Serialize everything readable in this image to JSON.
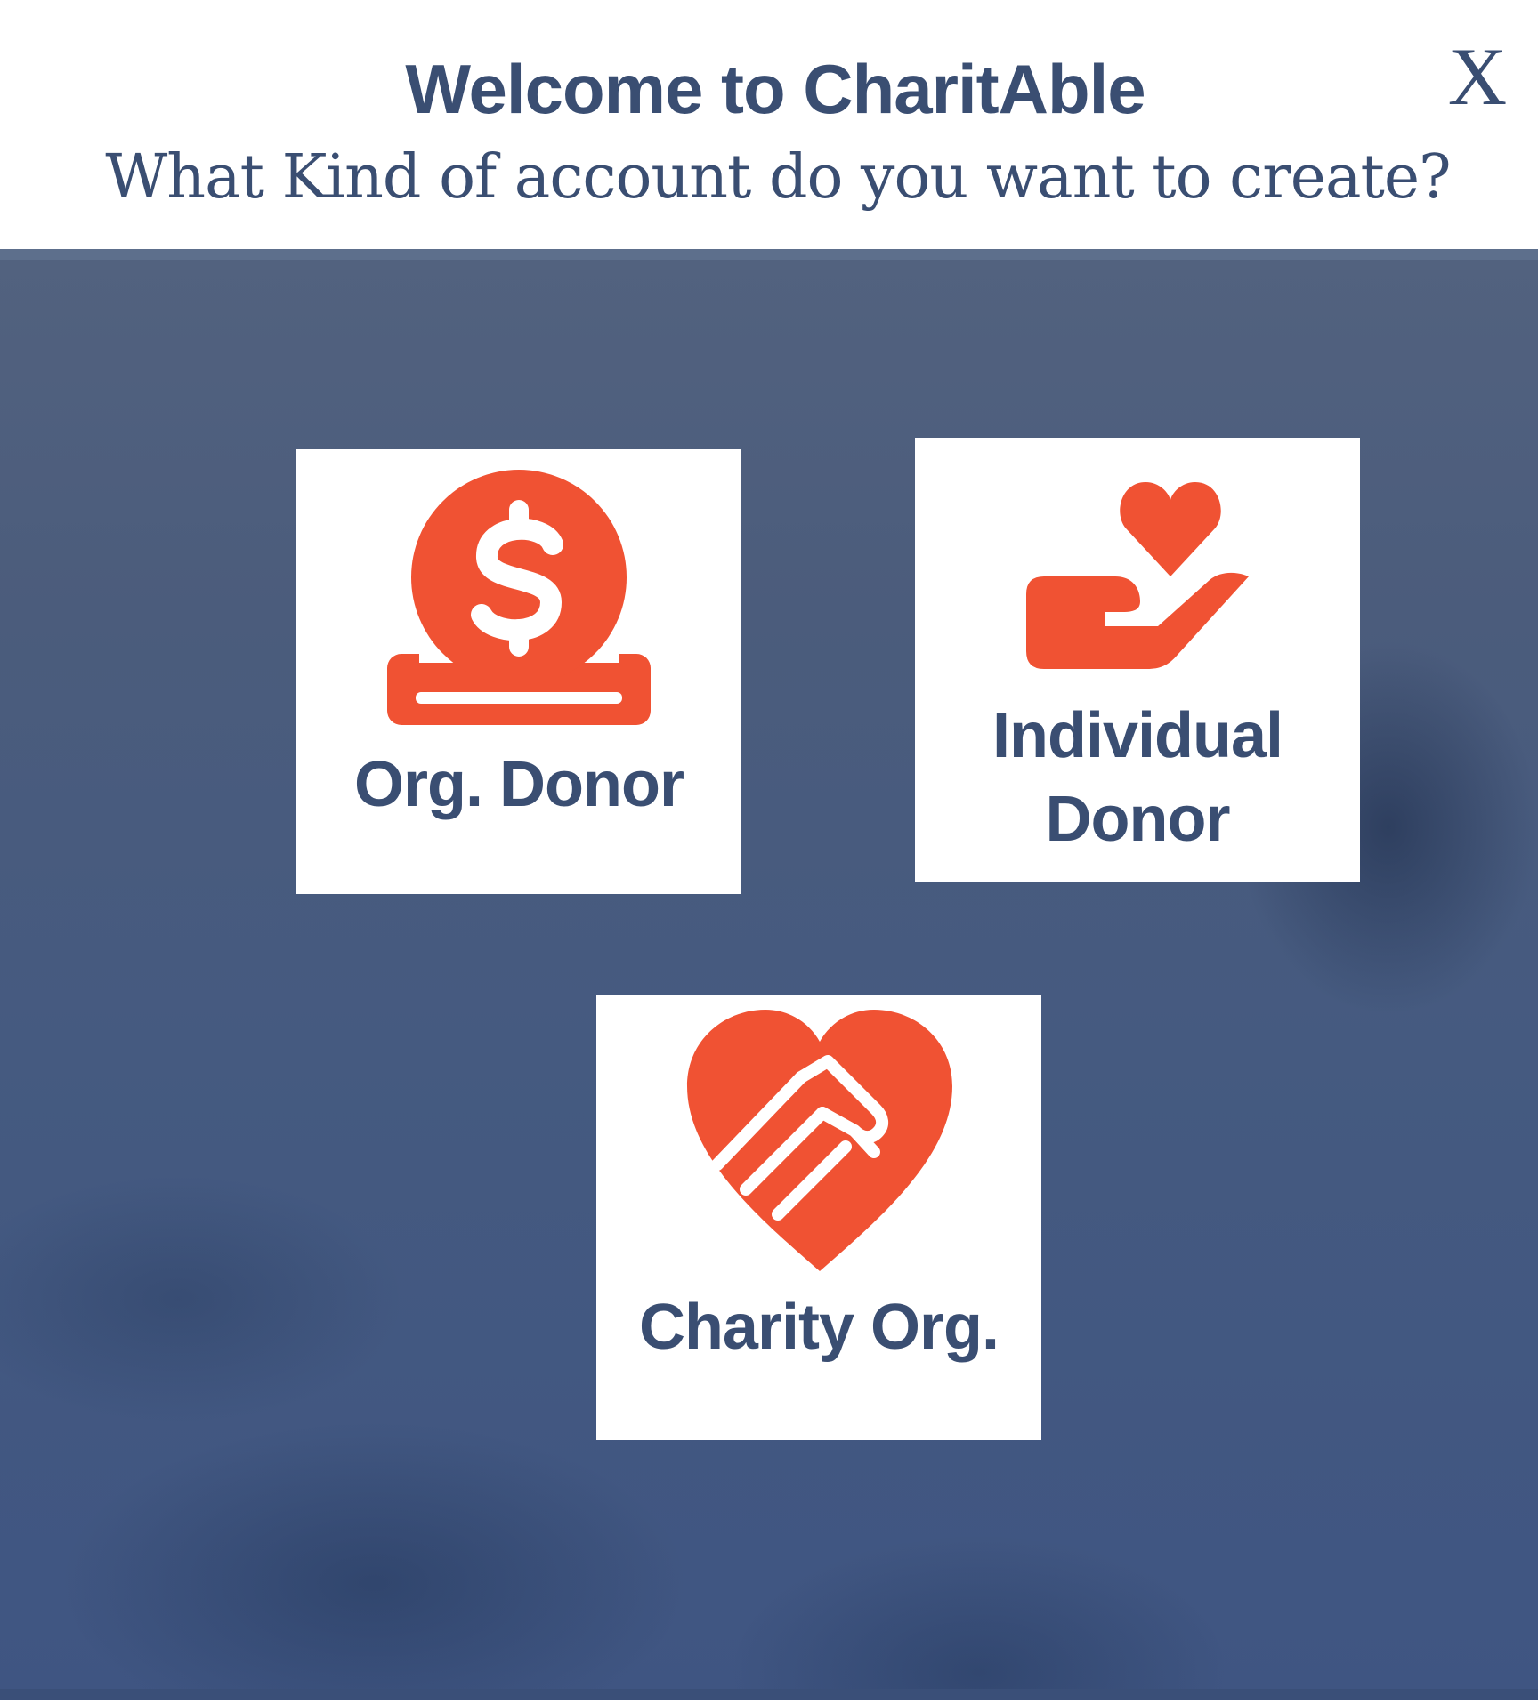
{
  "header": {
    "title": "Welcome to CharitAble",
    "subtitle": "What Kind of account do you want to create?",
    "close_label": "X"
  },
  "options": [
    {
      "label": "Org. Donor",
      "icon": "money-deposit-icon"
    },
    {
      "label_line1": "Individual",
      "label_line2": "Donor",
      "icon": "hand-heart-icon"
    },
    {
      "label": "Charity Org.",
      "icon": "heart-handshake-icon"
    }
  ],
  "colors": {
    "primary_text": "#3a4e72",
    "accent": "#f05233",
    "card_bg": "#ffffff",
    "overlay": "#465b80"
  }
}
